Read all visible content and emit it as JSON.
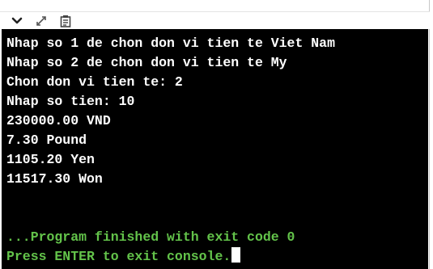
{
  "toolbar": {
    "icons": [
      "chevron-down-icon",
      "expand-icon",
      "copy-icon"
    ]
  },
  "console": {
    "lines": [
      "Nhap so 1 de chon don vi tien te Viet Nam",
      "Nhap so 2 de chon don vi tien te My",
      "Chon don vi tien te: 2",
      "Nhap so tien: 10",
      "230000.00 VND",
      "7.30 Pound",
      "1105.20 Yen",
      "11517.30 Won"
    ],
    "finished_message": "...Program finished with exit code 0",
    "prompt_message": "Press ENTER to exit console.",
    "colors": {
      "background": "#000000",
      "text": "#ffffff",
      "status": "#63c34a"
    }
  }
}
